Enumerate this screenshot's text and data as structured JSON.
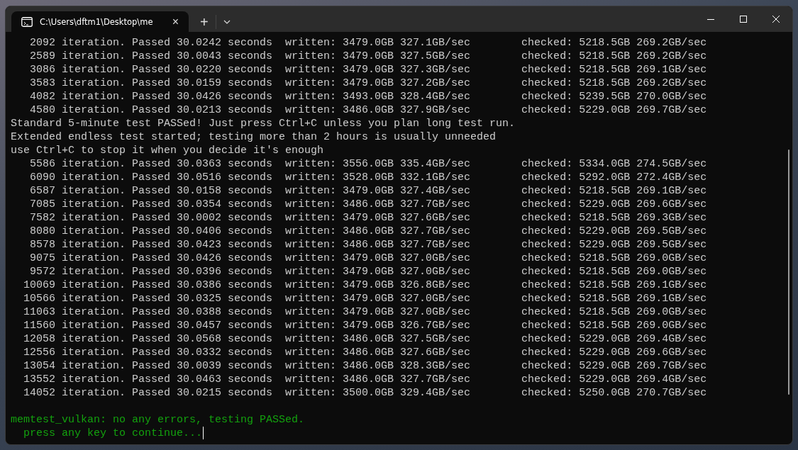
{
  "window": {
    "tab_title": "C:\\Users\\dftm1\\Desktop\\me",
    "tab_close": "×",
    "new_tab": "+"
  },
  "terminal": {
    "cursor_visible": true,
    "lines": [
      {
        "kind": "output",
        "text": "   2092 iteration. Passed 30.0242 seconds  written: 3479.0GB 327.1GB/sec        checked: 5218.5GB 269.2GB/sec"
      },
      {
        "kind": "output",
        "text": "   2589 iteration. Passed 30.0043 seconds  written: 3479.0GB 327.5GB/sec        checked: 5218.5GB 269.2GB/sec"
      },
      {
        "kind": "output",
        "text": "   3086 iteration. Passed 30.0220 seconds  written: 3479.0GB 327.3GB/sec        checked: 5218.5GB 269.1GB/sec"
      },
      {
        "kind": "output",
        "text": "   3583 iteration. Passed 30.0159 seconds  written: 3479.0GB 327.2GB/sec        checked: 5218.5GB 269.2GB/sec"
      },
      {
        "kind": "output",
        "text": "   4082 iteration. Passed 30.0426 seconds  written: 3493.0GB 328.4GB/sec        checked: 5239.5GB 270.0GB/sec"
      },
      {
        "kind": "output",
        "text": "   4580 iteration. Passed 30.0213 seconds  written: 3486.0GB 327.9GB/sec        checked: 5229.0GB 269.7GB/sec"
      },
      {
        "kind": "output",
        "text": "Standard 5-minute test PASSed! Just press Ctrl+C unless you plan long test run."
      },
      {
        "kind": "output",
        "text": "Extended endless test started; testing more than 2 hours is usually unneeded"
      },
      {
        "kind": "output",
        "text": "use Ctrl+C to stop it when you decide it's enough"
      },
      {
        "kind": "output",
        "text": "   5586 iteration. Passed 30.0363 seconds  written: 3556.0GB 335.4GB/sec        checked: 5334.0GB 274.5GB/sec"
      },
      {
        "kind": "output",
        "text": "   6090 iteration. Passed 30.0516 seconds  written: 3528.0GB 332.1GB/sec        checked: 5292.0GB 272.4GB/sec"
      },
      {
        "kind": "output",
        "text": "   6587 iteration. Passed 30.0158 seconds  written: 3479.0GB 327.4GB/sec        checked: 5218.5GB 269.1GB/sec"
      },
      {
        "kind": "output",
        "text": "   7085 iteration. Passed 30.0354 seconds  written: 3486.0GB 327.7GB/sec        checked: 5229.0GB 269.6GB/sec"
      },
      {
        "kind": "output",
        "text": "   7582 iteration. Passed 30.0002 seconds  written: 3479.0GB 327.6GB/sec        checked: 5218.5GB 269.3GB/sec"
      },
      {
        "kind": "output",
        "text": "   8080 iteration. Passed 30.0406 seconds  written: 3486.0GB 327.7GB/sec        checked: 5229.0GB 269.5GB/sec"
      },
      {
        "kind": "output",
        "text": "   8578 iteration. Passed 30.0423 seconds  written: 3486.0GB 327.7GB/sec        checked: 5229.0GB 269.5GB/sec"
      },
      {
        "kind": "output",
        "text": "   9075 iteration. Passed 30.0426 seconds  written: 3479.0GB 327.0GB/sec        checked: 5218.5GB 269.0GB/sec"
      },
      {
        "kind": "output",
        "text": "   9572 iteration. Passed 30.0396 seconds  written: 3479.0GB 327.0GB/sec        checked: 5218.5GB 269.0GB/sec"
      },
      {
        "kind": "output",
        "text": "  10069 iteration. Passed 30.0386 seconds  written: 3479.0GB 326.8GB/sec        checked: 5218.5GB 269.1GB/sec"
      },
      {
        "kind": "output",
        "text": "  10566 iteration. Passed 30.0325 seconds  written: 3479.0GB 327.0GB/sec        checked: 5218.5GB 269.1GB/sec"
      },
      {
        "kind": "output",
        "text": "  11063 iteration. Passed 30.0388 seconds  written: 3479.0GB 327.0GB/sec        checked: 5218.5GB 269.0GB/sec"
      },
      {
        "kind": "output",
        "text": "  11560 iteration. Passed 30.0457 seconds  written: 3479.0GB 326.7GB/sec        checked: 5218.5GB 269.0GB/sec"
      },
      {
        "kind": "output",
        "text": "  12058 iteration. Passed 30.0568 seconds  written: 3486.0GB 327.5GB/sec        checked: 5229.0GB 269.4GB/sec"
      },
      {
        "kind": "output",
        "text": "  12556 iteration. Passed 30.0332 seconds  written: 3486.0GB 327.6GB/sec        checked: 5229.0GB 269.6GB/sec"
      },
      {
        "kind": "output",
        "text": "  13054 iteration. Passed 30.0039 seconds  written: 3486.0GB 328.3GB/sec        checked: 5229.0GB 269.7GB/sec"
      },
      {
        "kind": "output",
        "text": "  13552 iteration. Passed 30.0463 seconds  written: 3486.0GB 327.7GB/sec        checked: 5229.0GB 269.4GB/sec"
      },
      {
        "kind": "output",
        "text": "  14052 iteration. Passed 30.0215 seconds  written: 3500.0GB 329.4GB/sec        checked: 5250.0GB 270.7GB/sec"
      },
      {
        "kind": "blank"
      },
      {
        "kind": "success",
        "text": "memtest_vulkan: no any errors, testing PASSed."
      },
      {
        "kind": "success",
        "text": "  press any key to continue..."
      }
    ]
  }
}
